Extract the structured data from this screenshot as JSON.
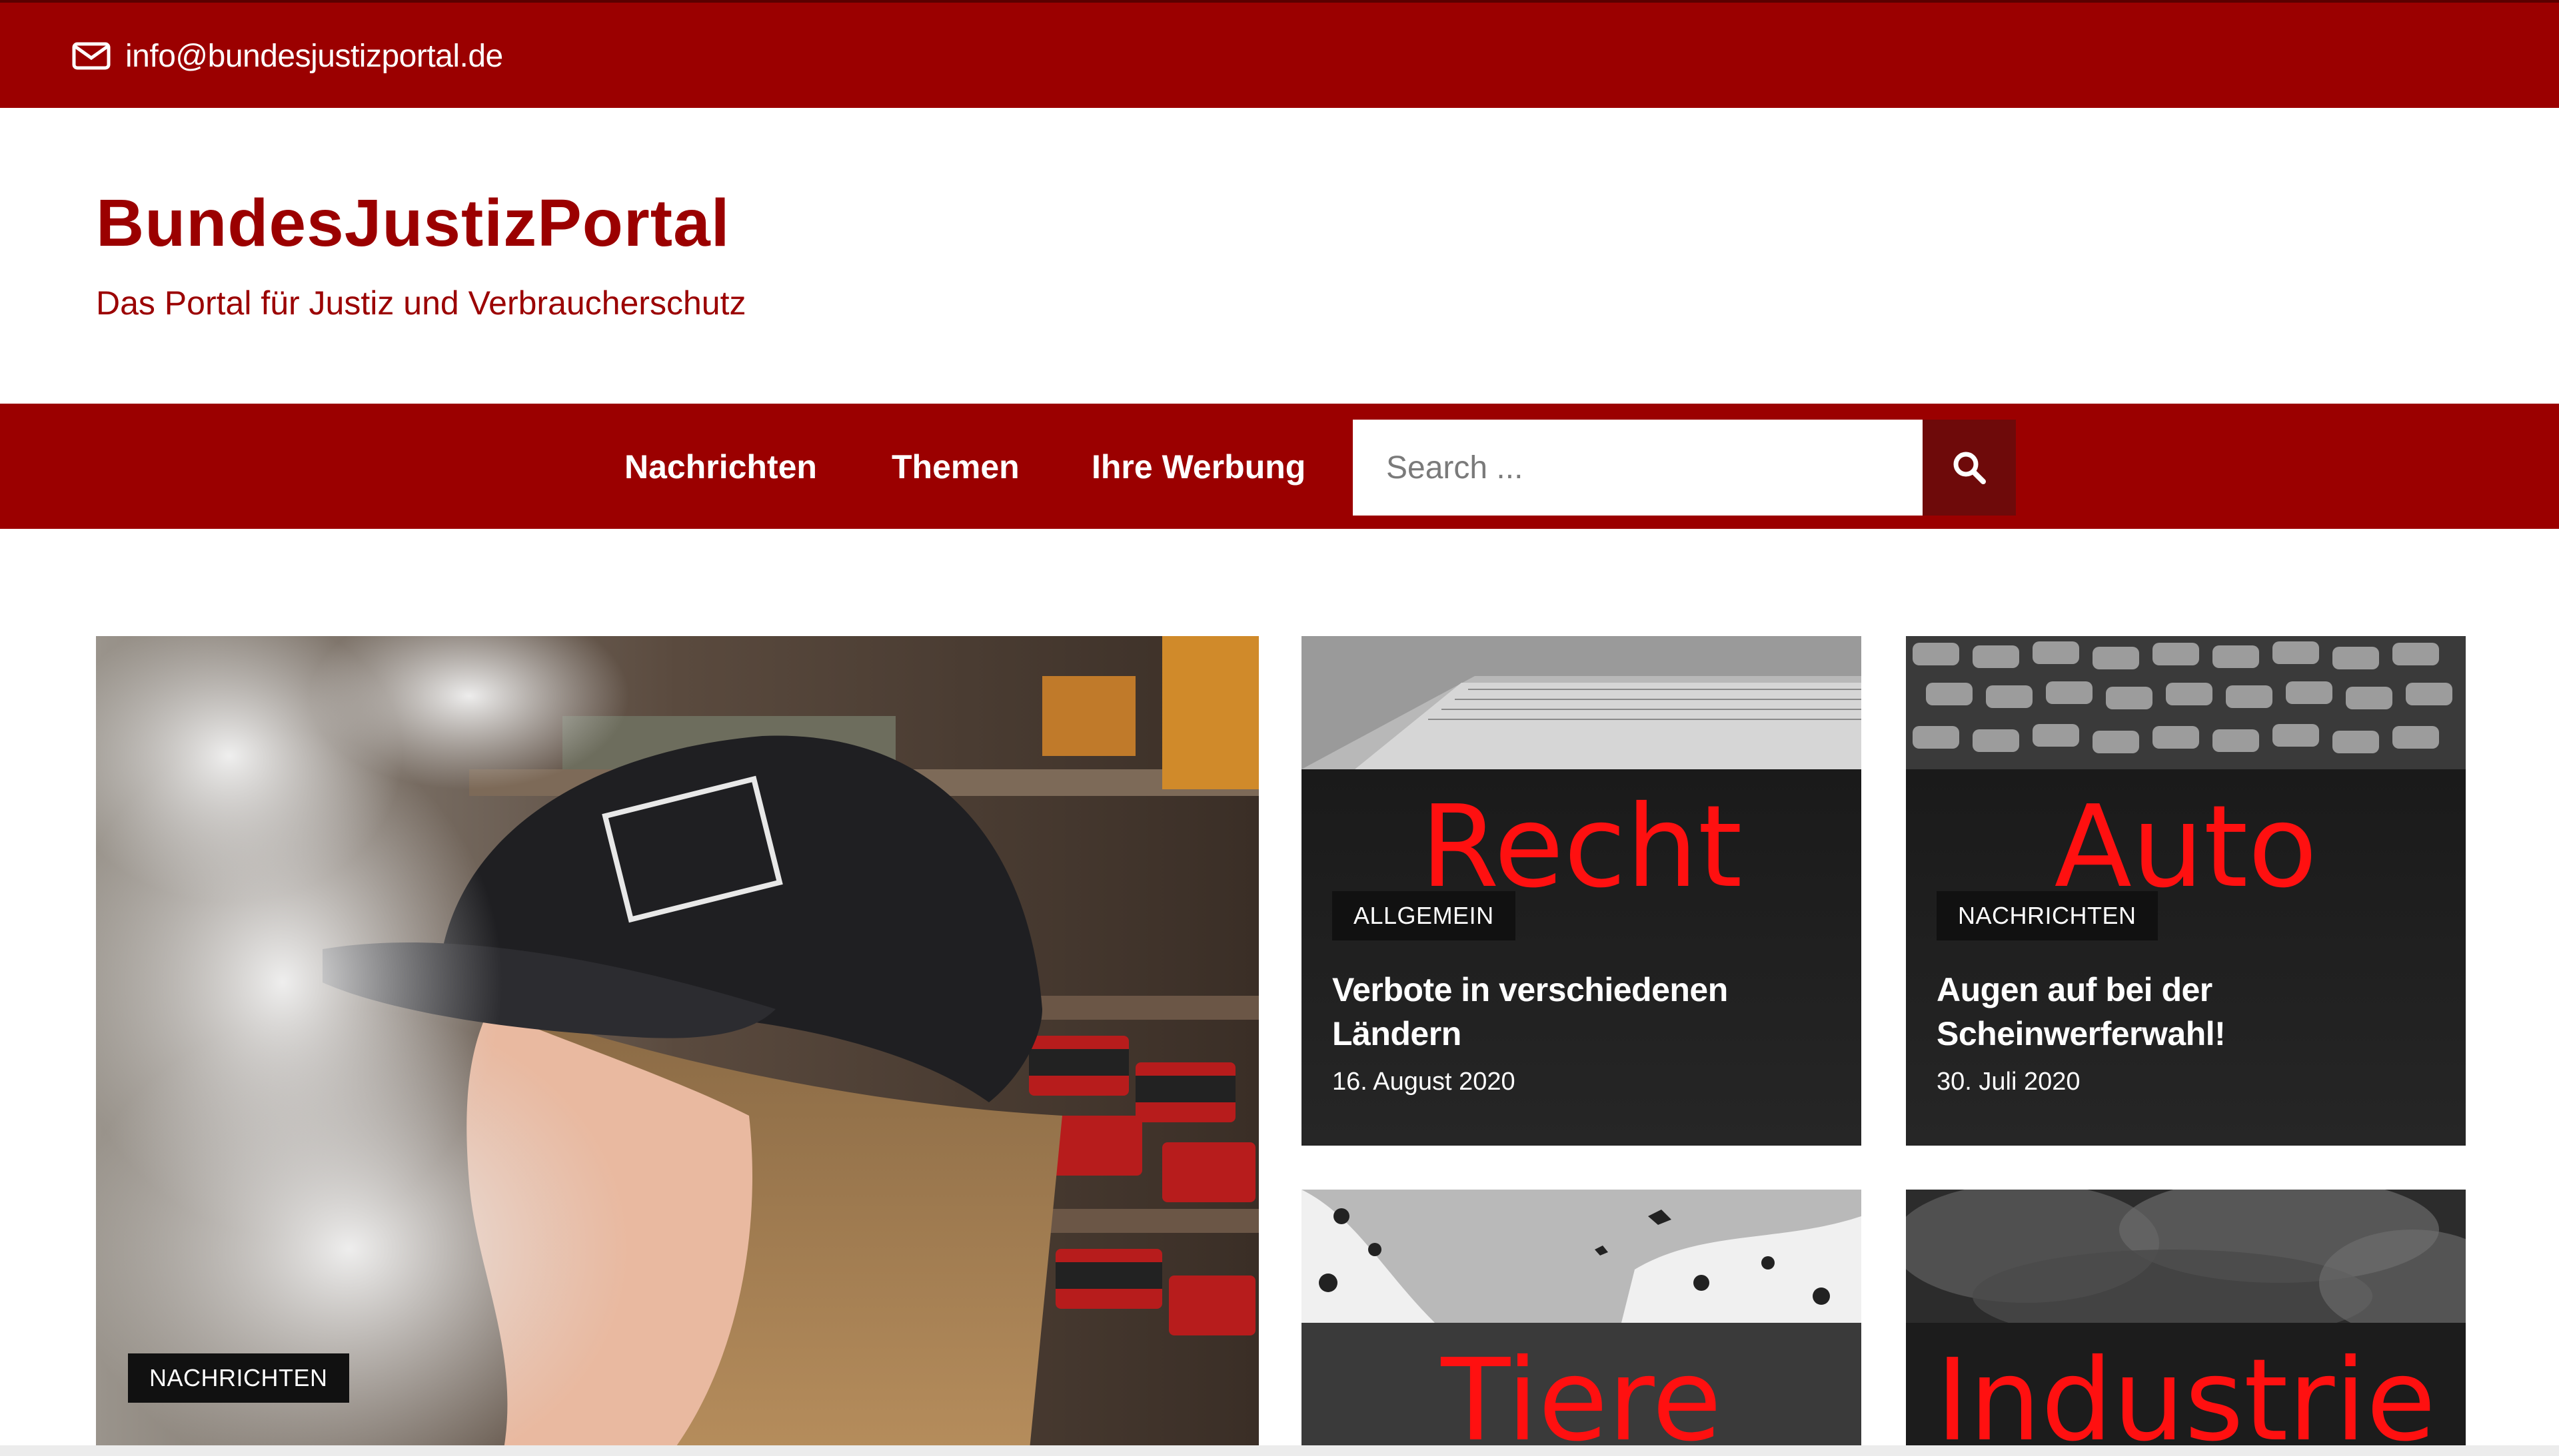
{
  "topbar": {
    "email": "info@bundesjustizportal.de",
    "icon": "mail-icon"
  },
  "branding": {
    "title": "BundesJustizPortal",
    "tagline": "Das Portal für Justiz und Verbraucherschutz"
  },
  "nav": {
    "items": [
      {
        "label": "Nachrichten"
      },
      {
        "label": "Themen"
      },
      {
        "label": "Ihre Werbung"
      }
    ],
    "search": {
      "placeholder": "Search ...",
      "button_icon": "search-icon"
    }
  },
  "hero": {
    "badge": "NACHRICHTEN"
  },
  "cards": [
    {
      "overlay_word": "Recht",
      "badge": "ALLGEMEIN",
      "title": "Verbote in verschiedenen Ländern",
      "date": "16. August 2020"
    },
    {
      "overlay_word": "Auto",
      "badge": "NACHRICHTEN",
      "title": "Augen auf bei der Scheinwerferwahl!",
      "date": "30. Juli 2020"
    },
    {
      "overlay_word": "Tiere"
    },
    {
      "overlay_word": "Industrie"
    }
  ],
  "colors": {
    "brand_red": "#9b0000",
    "search_button": "#6e0a0a",
    "overlay_text_red": "#ff1010"
  }
}
